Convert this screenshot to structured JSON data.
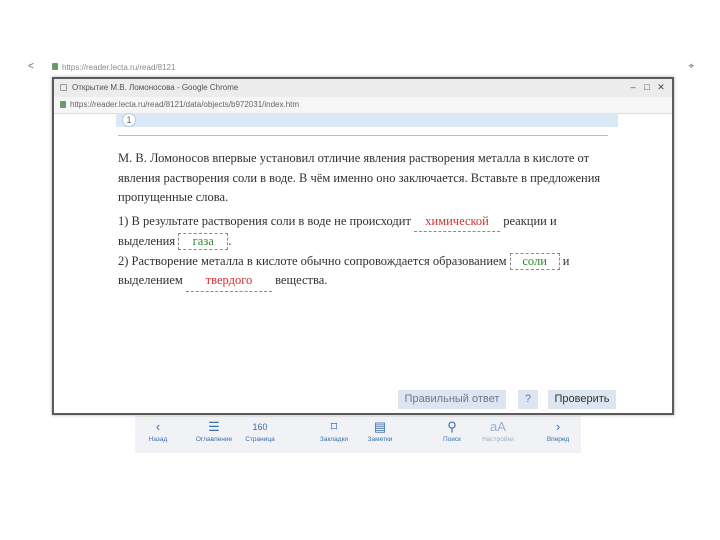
{
  "outer_browser": {
    "url": "https://reader.lecta.ru/read/8121",
    "nav_glyph": "<",
    "pin_glyph": "⌖"
  },
  "window": {
    "title": "Открытие М.В. Ломоносова - Google Chrome",
    "controls": [
      "–",
      "□",
      "✕"
    ],
    "url": "https://reader.lecta.ru/read/8121/data/objects/b972031/index.htm"
  },
  "task": {
    "number": "1",
    "intro": "М. В. Ломоносов впервые установил отличие явления растворения металла в кислоте от явления растворения соли в воде. В чём именно оно заключается. Вставьте в предложения пропущенные слова.",
    "line1_a": "1) В результате растворения соли в воде не происходит",
    "blank1": "химической",
    "line1_b": "реакции и выделения",
    "blank2": "газа",
    "line1_c": ".",
    "line2_a": "2) Растворение металла в кислоте обычно сопровождается образованием",
    "blank3": "соли",
    "line2_b": "и выделением",
    "blank4": "твердого",
    "line2_c": "вещества."
  },
  "buttons": {
    "answer": "Правильный ответ",
    "help": "?",
    "check": "Проверить"
  },
  "toolbar": {
    "items": [
      {
        "label": "Назад",
        "icon": "‹"
      },
      {
        "label": "Оглавление",
        "icon": "☰"
      },
      {
        "label": "Страница",
        "icon": "160"
      },
      {
        "label": "Закладки",
        "icon": "⌑"
      },
      {
        "label": "Заметки",
        "icon": "▤"
      },
      {
        "label": "Поиск",
        "icon": "⚲"
      },
      {
        "label": "Настройки",
        "icon": "aA"
      },
      {
        "label": "Вперед",
        "icon": "›"
      }
    ]
  },
  "colors": {
    "wrong_answer": "#d0322f",
    "correct_answer": "#2e8b2e",
    "accent": "#3a6fb0",
    "button_bg": "#dde6f0"
  }
}
